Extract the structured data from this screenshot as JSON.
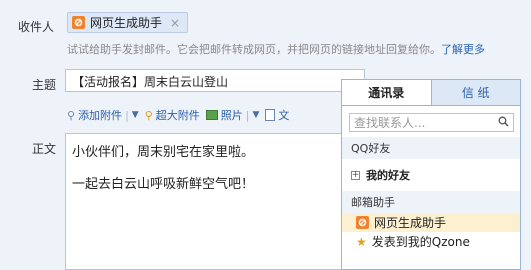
{
  "compose": {
    "to_label": "收件人",
    "recipient": {
      "name": "网页生成助手",
      "remove": "×"
    },
    "hint": {
      "text": "试试给助手发封邮件。它会把邮件转成网页，并把网页的链接地址回复给你。",
      "link": "了解更多"
    },
    "subject_label": "主题",
    "subject_value": "【活动报名】周末白云山登山",
    "toolbar": {
      "attach": "添加附件",
      "big_attach": "超大附件",
      "photo": "照片",
      "doc": "文"
    },
    "body_label": "正文",
    "body_lines": [
      "小伙伴们，周末别宅在家里啦。",
      "一起去白云山呼吸新鲜空气吧！"
    ]
  },
  "contacts": {
    "tabs": [
      "通讯录",
      "信 纸"
    ],
    "search_placeholder": "查找联系人...",
    "groups": {
      "qq": "QQ好友",
      "my_friends": "我的好友",
      "mail_helper": "邮箱助手"
    },
    "items": [
      "网页生成助手",
      "发表到我的Qzone"
    ]
  },
  "colors": {
    "accent": "#2a5fa8",
    "highlight": "#fdf0d0",
    "background": "#eef3fa"
  }
}
